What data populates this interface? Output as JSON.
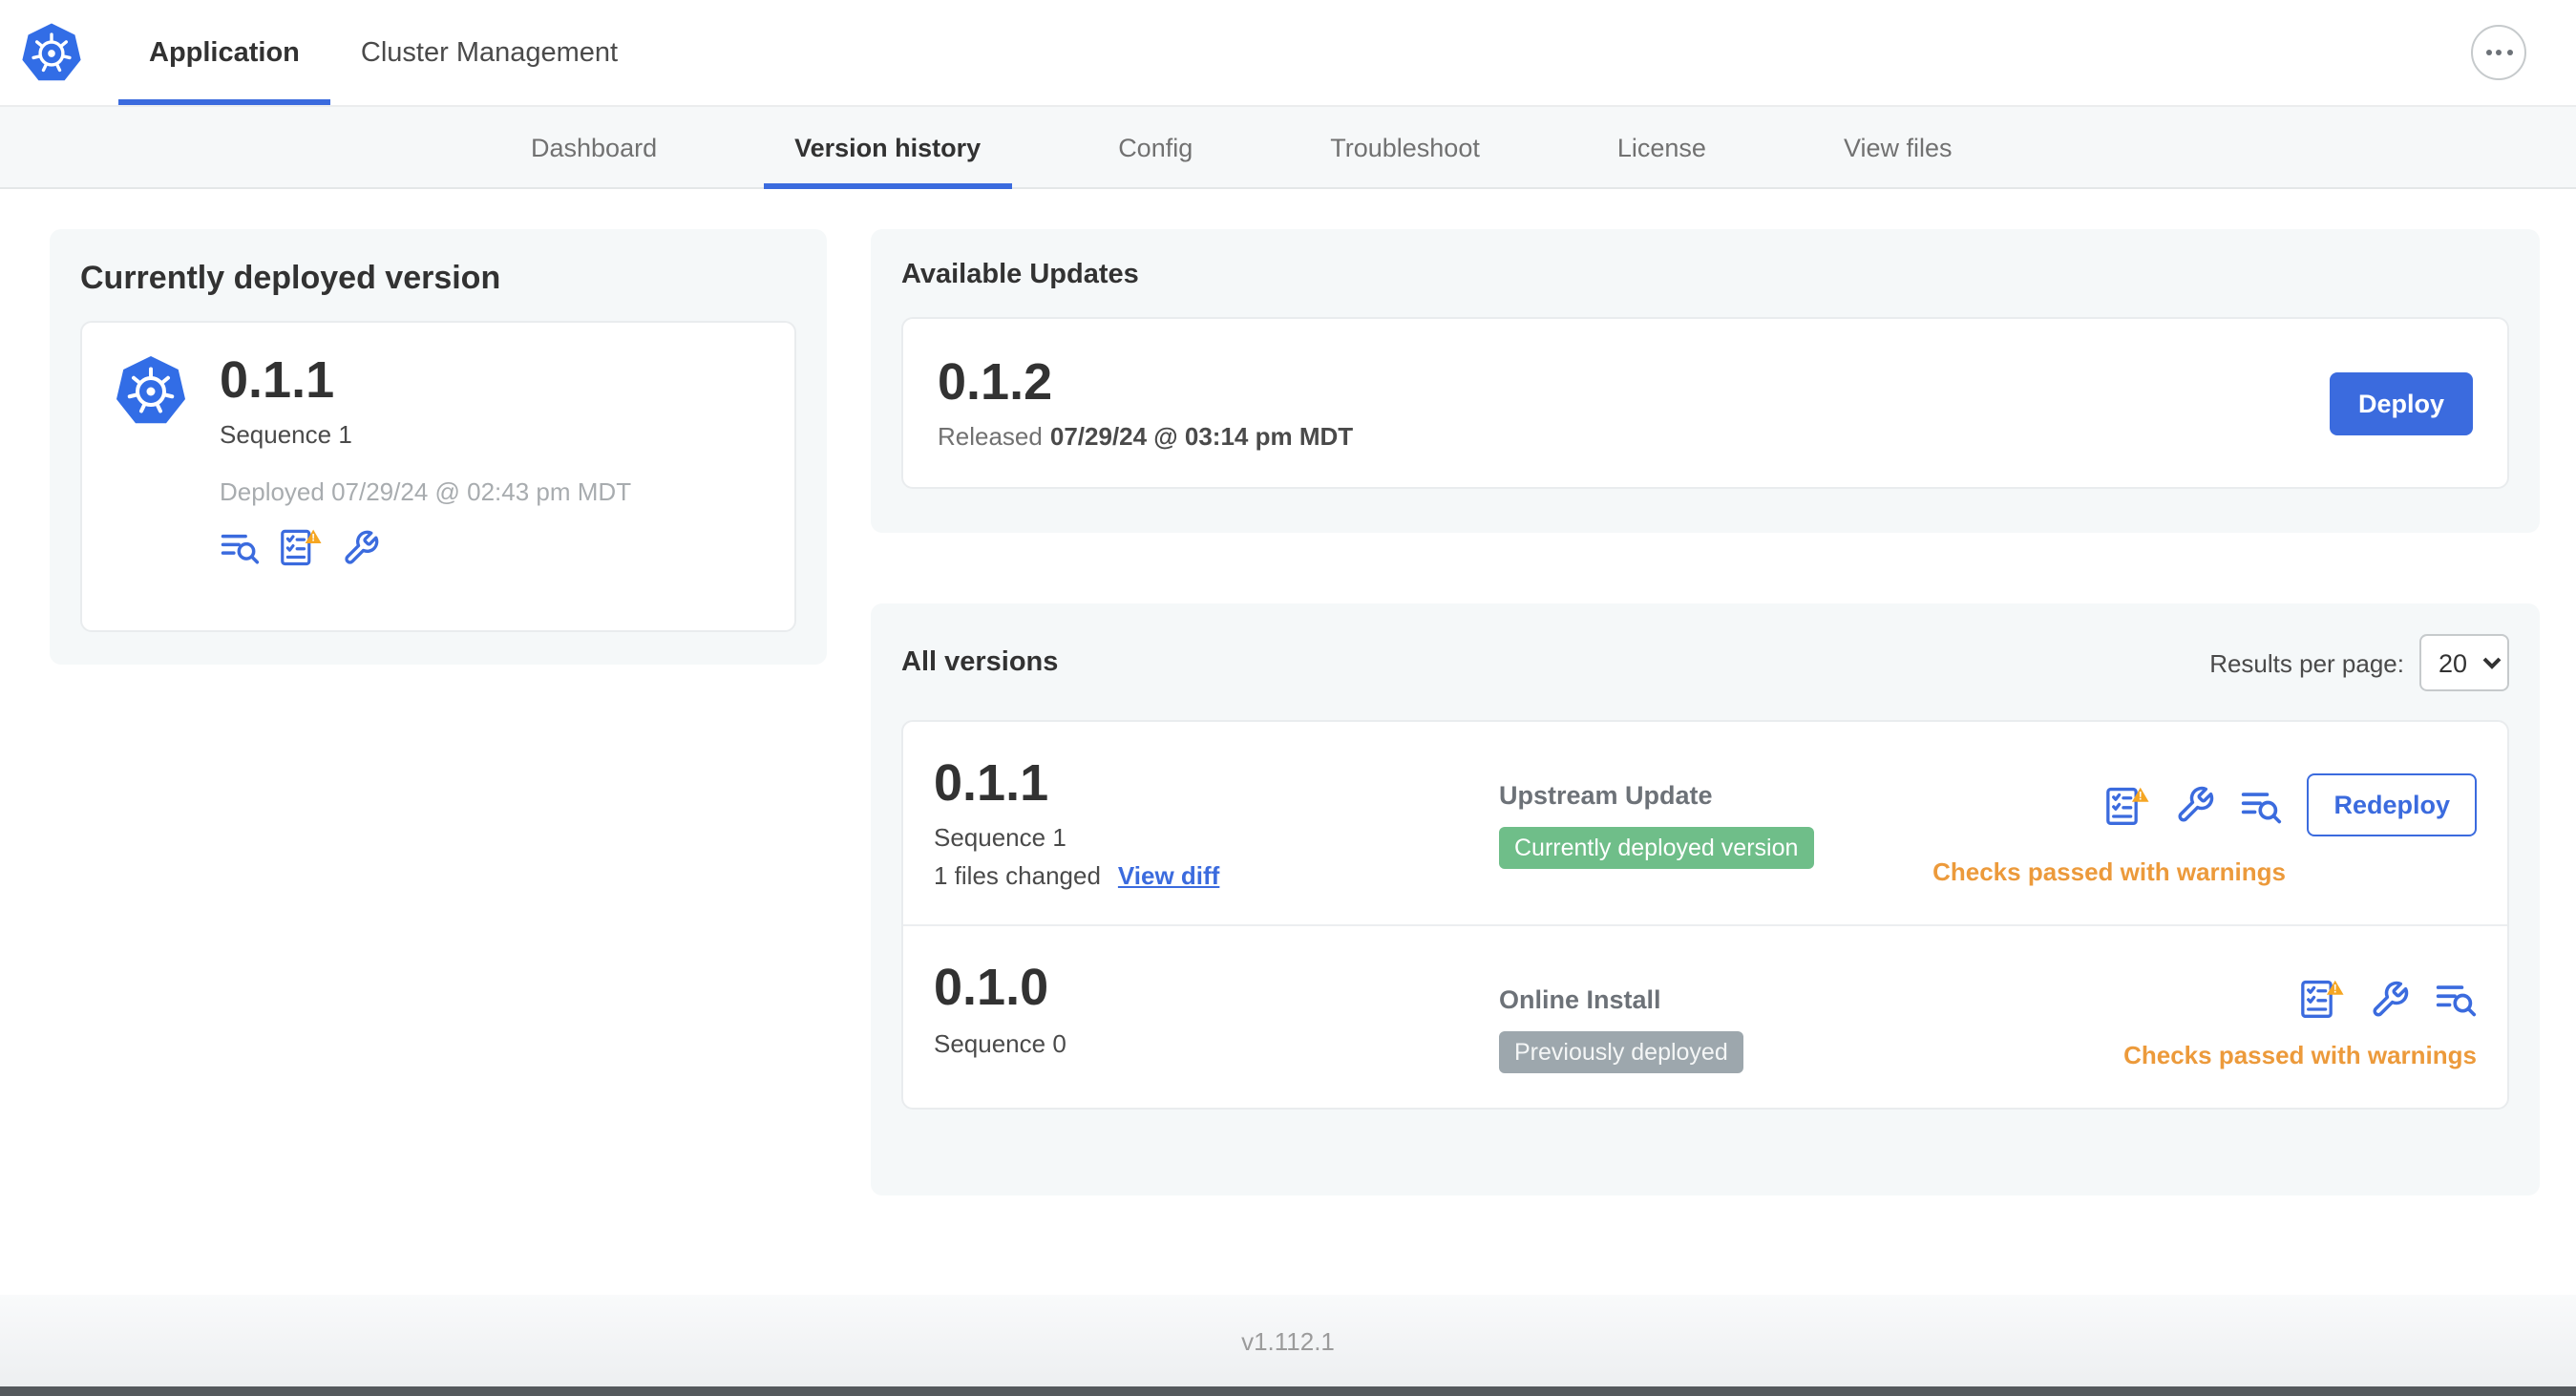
{
  "colors": {
    "accent_blue": "#3B6BDE",
    "kubernetes_blue": "#326DE6",
    "warning_orange": "#EC9A3B",
    "warning_triangle": "#F5A623",
    "success_green_badge": "#6FBE89",
    "gray_badge": "#9DA7AD",
    "panel_background": "#F5F8F9"
  },
  "icons": {
    "app_logo": "kubernetes-logo",
    "overflow_menu": "ellipsis-icon",
    "version_action_icons": [
      "preflight-checks-icon",
      "config-icon",
      "logs-icon"
    ],
    "warning_overlay": "warning-triangle-icon",
    "results_select_chevron": "chevron-down-icon"
  },
  "topnav": {
    "tabs": [
      {
        "label": "Application"
      },
      {
        "label": "Cluster Management"
      }
    ]
  },
  "subnav": {
    "tabs": [
      "Dashboard",
      "Version history",
      "Config",
      "Troubleshoot",
      "License",
      "View files"
    ],
    "active_tab": "Version history"
  },
  "deployed_card": {
    "title": "Currently deployed version",
    "version": "0.1.1",
    "sequence": "Sequence 1",
    "deployed_at": "Deployed 07/29/24 @ 02:43 pm MDT"
  },
  "available_updates": {
    "title": "Available Updates",
    "version": "0.1.2",
    "released_label": "Released",
    "released_date": "07/29/24 @ 03:14 pm MDT",
    "deploy_button": "Deploy"
  },
  "all_versions": {
    "title": "All versions",
    "results_per_page_label": "Results per page:",
    "results_per_page_value": "20",
    "rows": [
      {
        "version": "0.1.1",
        "sequence": "Sequence 1",
        "files_changed": "1 files changed",
        "view_diff_link": "View diff",
        "source": "Upstream Update",
        "badge": "Currently deployed version",
        "status": "Checks passed with warnings",
        "action_button": "Redeploy"
      },
      {
        "version": "0.1.0",
        "sequence": "Sequence 0",
        "source": "Online Install",
        "badge": "Previously deployed",
        "status": "Checks passed with warnings"
      }
    ]
  },
  "footer": {
    "app_version": "v1.112.1"
  }
}
